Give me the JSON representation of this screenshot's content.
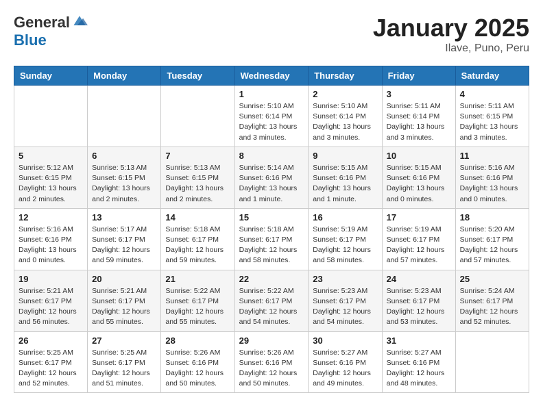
{
  "header": {
    "logo_general": "General",
    "logo_blue": "Blue",
    "month_title": "January 2025",
    "location": "Ilave, Puno, Peru"
  },
  "days_of_week": [
    "Sunday",
    "Monday",
    "Tuesday",
    "Wednesday",
    "Thursday",
    "Friday",
    "Saturday"
  ],
  "weeks": [
    [
      {
        "day": "",
        "info": ""
      },
      {
        "day": "",
        "info": ""
      },
      {
        "day": "",
        "info": ""
      },
      {
        "day": "1",
        "info": "Sunrise: 5:10 AM\nSunset: 6:14 PM\nDaylight: 13 hours and 3 minutes."
      },
      {
        "day": "2",
        "info": "Sunrise: 5:10 AM\nSunset: 6:14 PM\nDaylight: 13 hours and 3 minutes."
      },
      {
        "day": "3",
        "info": "Sunrise: 5:11 AM\nSunset: 6:14 PM\nDaylight: 13 hours and 3 minutes."
      },
      {
        "day": "4",
        "info": "Sunrise: 5:11 AM\nSunset: 6:15 PM\nDaylight: 13 hours and 3 minutes."
      }
    ],
    [
      {
        "day": "5",
        "info": "Sunrise: 5:12 AM\nSunset: 6:15 PM\nDaylight: 13 hours and 2 minutes."
      },
      {
        "day": "6",
        "info": "Sunrise: 5:13 AM\nSunset: 6:15 PM\nDaylight: 13 hours and 2 minutes."
      },
      {
        "day": "7",
        "info": "Sunrise: 5:13 AM\nSunset: 6:15 PM\nDaylight: 13 hours and 2 minutes."
      },
      {
        "day": "8",
        "info": "Sunrise: 5:14 AM\nSunset: 6:16 PM\nDaylight: 13 hours and 1 minute."
      },
      {
        "day": "9",
        "info": "Sunrise: 5:15 AM\nSunset: 6:16 PM\nDaylight: 13 hours and 1 minute."
      },
      {
        "day": "10",
        "info": "Sunrise: 5:15 AM\nSunset: 6:16 PM\nDaylight: 13 hours and 0 minutes."
      },
      {
        "day": "11",
        "info": "Sunrise: 5:16 AM\nSunset: 6:16 PM\nDaylight: 13 hours and 0 minutes."
      }
    ],
    [
      {
        "day": "12",
        "info": "Sunrise: 5:16 AM\nSunset: 6:16 PM\nDaylight: 13 hours and 0 minutes."
      },
      {
        "day": "13",
        "info": "Sunrise: 5:17 AM\nSunset: 6:17 PM\nDaylight: 12 hours and 59 minutes."
      },
      {
        "day": "14",
        "info": "Sunrise: 5:18 AM\nSunset: 6:17 PM\nDaylight: 12 hours and 59 minutes."
      },
      {
        "day": "15",
        "info": "Sunrise: 5:18 AM\nSunset: 6:17 PM\nDaylight: 12 hours and 58 minutes."
      },
      {
        "day": "16",
        "info": "Sunrise: 5:19 AM\nSunset: 6:17 PM\nDaylight: 12 hours and 58 minutes."
      },
      {
        "day": "17",
        "info": "Sunrise: 5:19 AM\nSunset: 6:17 PM\nDaylight: 12 hours and 57 minutes."
      },
      {
        "day": "18",
        "info": "Sunrise: 5:20 AM\nSunset: 6:17 PM\nDaylight: 12 hours and 57 minutes."
      }
    ],
    [
      {
        "day": "19",
        "info": "Sunrise: 5:21 AM\nSunset: 6:17 PM\nDaylight: 12 hours and 56 minutes."
      },
      {
        "day": "20",
        "info": "Sunrise: 5:21 AM\nSunset: 6:17 PM\nDaylight: 12 hours and 55 minutes."
      },
      {
        "day": "21",
        "info": "Sunrise: 5:22 AM\nSunset: 6:17 PM\nDaylight: 12 hours and 55 minutes."
      },
      {
        "day": "22",
        "info": "Sunrise: 5:22 AM\nSunset: 6:17 PM\nDaylight: 12 hours and 54 minutes."
      },
      {
        "day": "23",
        "info": "Sunrise: 5:23 AM\nSunset: 6:17 PM\nDaylight: 12 hours and 54 minutes."
      },
      {
        "day": "24",
        "info": "Sunrise: 5:23 AM\nSunset: 6:17 PM\nDaylight: 12 hours and 53 minutes."
      },
      {
        "day": "25",
        "info": "Sunrise: 5:24 AM\nSunset: 6:17 PM\nDaylight: 12 hours and 52 minutes."
      }
    ],
    [
      {
        "day": "26",
        "info": "Sunrise: 5:25 AM\nSunset: 6:17 PM\nDaylight: 12 hours and 52 minutes."
      },
      {
        "day": "27",
        "info": "Sunrise: 5:25 AM\nSunset: 6:17 PM\nDaylight: 12 hours and 51 minutes."
      },
      {
        "day": "28",
        "info": "Sunrise: 5:26 AM\nSunset: 6:16 PM\nDaylight: 12 hours and 50 minutes."
      },
      {
        "day": "29",
        "info": "Sunrise: 5:26 AM\nSunset: 6:16 PM\nDaylight: 12 hours and 50 minutes."
      },
      {
        "day": "30",
        "info": "Sunrise: 5:27 AM\nSunset: 6:16 PM\nDaylight: 12 hours and 49 minutes."
      },
      {
        "day": "31",
        "info": "Sunrise: 5:27 AM\nSunset: 6:16 PM\nDaylight: 12 hours and 48 minutes."
      },
      {
        "day": "",
        "info": ""
      }
    ]
  ]
}
